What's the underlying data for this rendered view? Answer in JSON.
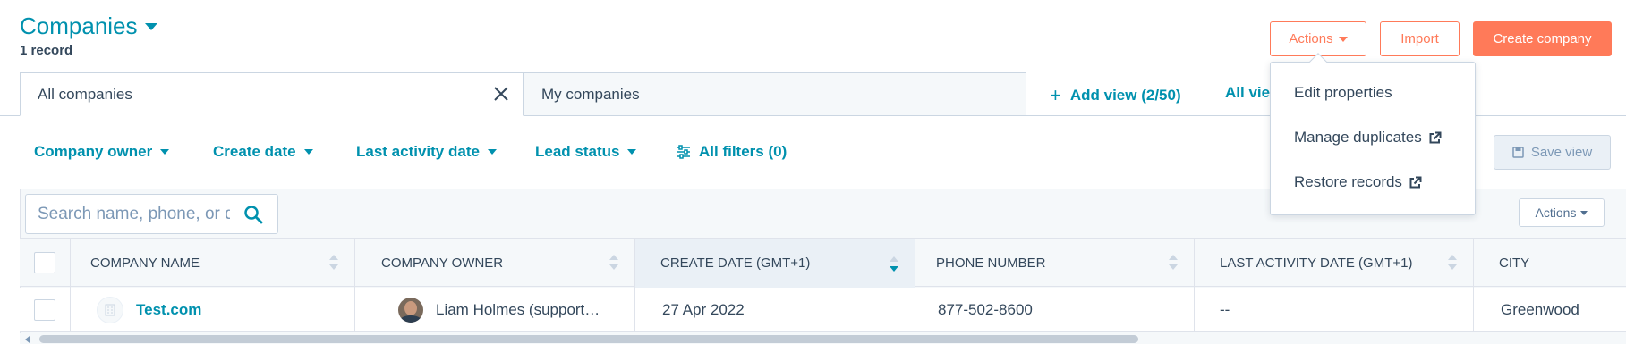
{
  "header": {
    "title": "Companies",
    "record_count": "1 record",
    "actions_label": "Actions",
    "import_label": "Import",
    "create_label": "Create company"
  },
  "actions_menu": {
    "items": [
      {
        "label": "Edit properties",
        "icon": null
      },
      {
        "label": "Manage duplicates",
        "icon": "external-link-icon"
      },
      {
        "label": "Restore records",
        "icon": "external-link-icon"
      }
    ]
  },
  "views": {
    "tabs": [
      {
        "label": "All companies",
        "active": true,
        "closable": true
      },
      {
        "label": "My companies",
        "active": false,
        "closable": false
      }
    ],
    "add_view_label": "Add view (2/50)",
    "all_views_label": "All views"
  },
  "filters": {
    "items": [
      "Company owner",
      "Create date",
      "Last activity date",
      "Lead status"
    ],
    "all_filters_label": "All filters (0)",
    "save_view_label": "Save view"
  },
  "table": {
    "search_placeholder": "Search name, phone, or domain",
    "actions_label": "Actions",
    "columns": [
      "COMPANY NAME",
      "COMPANY OWNER",
      "CREATE DATE (GMT+1)",
      "PHONE NUMBER",
      "LAST ACTIVITY DATE (GMT+1)",
      "CITY"
    ],
    "sorted_column": "CREATE DATE (GMT+1)",
    "rows": [
      {
        "company_name": "Test.com",
        "company_owner": "Liam Holmes (support…",
        "create_date": "27 Apr 2022",
        "phone_number": "877-502-8600",
        "last_activity_date": "--",
        "city": "Greenwood"
      }
    ]
  },
  "colors": {
    "accent": "#0091ae",
    "brand": "#ff7a59",
    "text": "#33475b",
    "border": "#cbd6e2"
  }
}
